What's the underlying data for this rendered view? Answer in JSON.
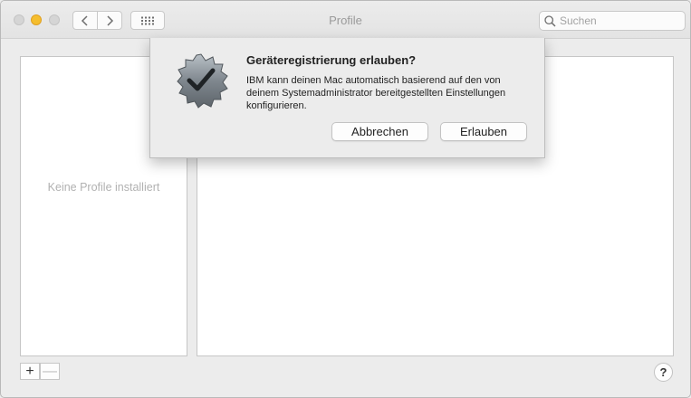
{
  "window": {
    "title": "Profile",
    "controls": [
      "close",
      "minimize",
      "maximize"
    ]
  },
  "toolbar": {
    "back_icon": "chevron-left-icon",
    "forward_icon": "chevron-right-icon",
    "grid_icon": "grid-icon",
    "search": {
      "placeholder": "Suchen",
      "value": "",
      "icon": "search-icon"
    }
  },
  "sidebar": {
    "empty_label": "Keine Profile installiert",
    "add_label": "+",
    "remove_label": "—"
  },
  "help": {
    "label": "?"
  },
  "dialog": {
    "icon": "verified-badge-icon",
    "title": "Geräteregistrierung erlauben?",
    "message": "IBM kann deinen Mac automatisch basierend auf den von deinem Systemadministrator bereitgestellten Einstellungen konfigurieren.",
    "cancel_label": "Abbrechen",
    "allow_label": "Erlauben"
  },
  "colors": {
    "window_bg": "#ececec",
    "minimize_yellow": "#f5be2e",
    "panel_bg": "#ffffff"
  }
}
